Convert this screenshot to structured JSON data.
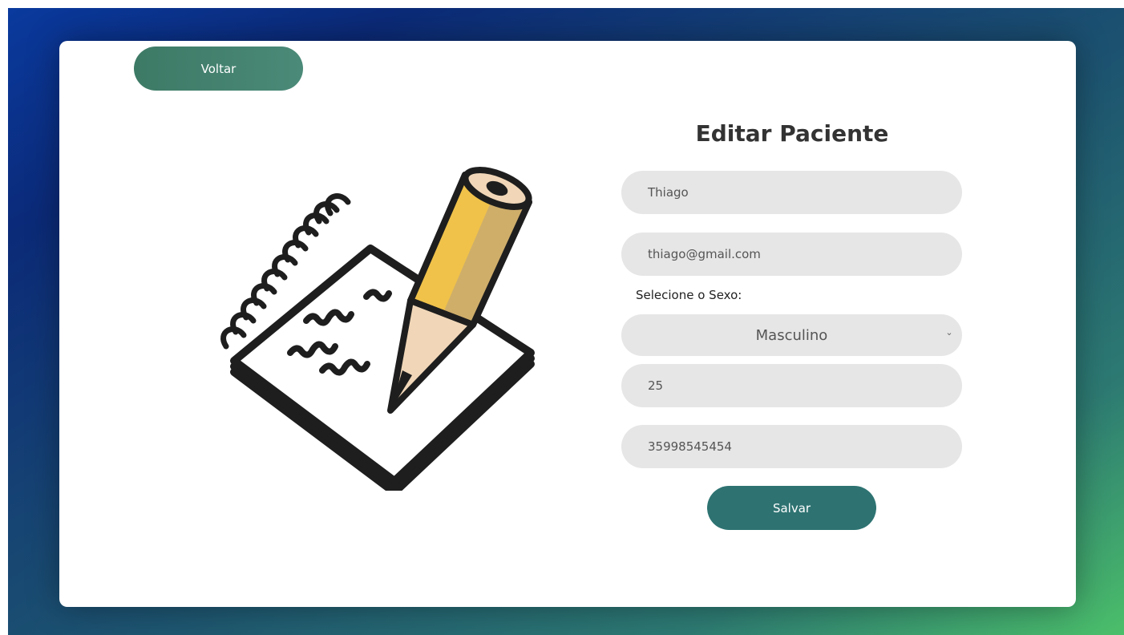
{
  "nav": {
    "back_label": "Voltar"
  },
  "form": {
    "title": "Editar Paciente",
    "name_value": "Thiago",
    "email_value": "thiago@gmail.com",
    "sex_label": "Selecione o Sexo:",
    "sex_selected": "Masculino",
    "age_value": "25",
    "phone_value": "35998545454",
    "save_label": "Salvar"
  },
  "icons": {
    "illustration": "notepad-pencil-icon",
    "select_arrow": "chevron-down-icon"
  },
  "colors": {
    "back_button": "#427f6d",
    "save_button": "#2e7372",
    "field_background": "#e6e6e6",
    "gradient_start": "#0a3a9e",
    "gradient_end": "#4bbf6a"
  }
}
